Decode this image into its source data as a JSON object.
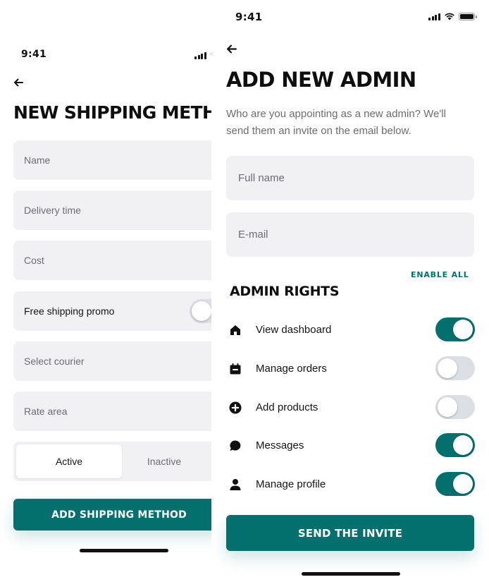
{
  "left_screen": {
    "status_time": "9:41",
    "title": "NEW SHIPPING METHOD",
    "fields": {
      "name_placeholder": "Name",
      "delivery_time_placeholder": "Delivery time",
      "cost_placeholder": "Cost",
      "free_shipping_label": "Free shipping promo",
      "free_shipping_on": false,
      "courier_placeholder": "Select courier",
      "rate_area_placeholder": "Rate area"
    },
    "status_segments": [
      "Active",
      "Inactive"
    ],
    "selected_segment": "Active",
    "submit_label": "ADD SHIPPING METHOD"
  },
  "right_screen": {
    "status_time": "9:41",
    "title": "ADD NEW ADMIN",
    "subtitle": "Who are you appointing as a new admin? We'll send them an invite on the email below.",
    "full_name_placeholder": "Full name",
    "email_placeholder": "E-mail",
    "enable_all_label": "ENABLE ALL",
    "rights_title": "ADMIN RIGHTS",
    "rights": [
      {
        "label": "View dashboard",
        "icon": "home-icon",
        "enabled": true
      },
      {
        "label": "Manage orders",
        "icon": "calendar-icon",
        "enabled": false
      },
      {
        "label": "Add products",
        "icon": "plus-circle-icon",
        "enabled": false
      },
      {
        "label": "Messages",
        "icon": "chat-bubble-icon",
        "enabled": true
      },
      {
        "label": "Manage profile",
        "icon": "person-icon",
        "enabled": true
      }
    ],
    "submit_label": "SEND THE INVITE"
  },
  "colors": {
    "accent": "#04706d",
    "field_background": "#f1f1f4",
    "placeholder_text": "#6d6d72",
    "toggle_off": "#dcdfe3"
  }
}
